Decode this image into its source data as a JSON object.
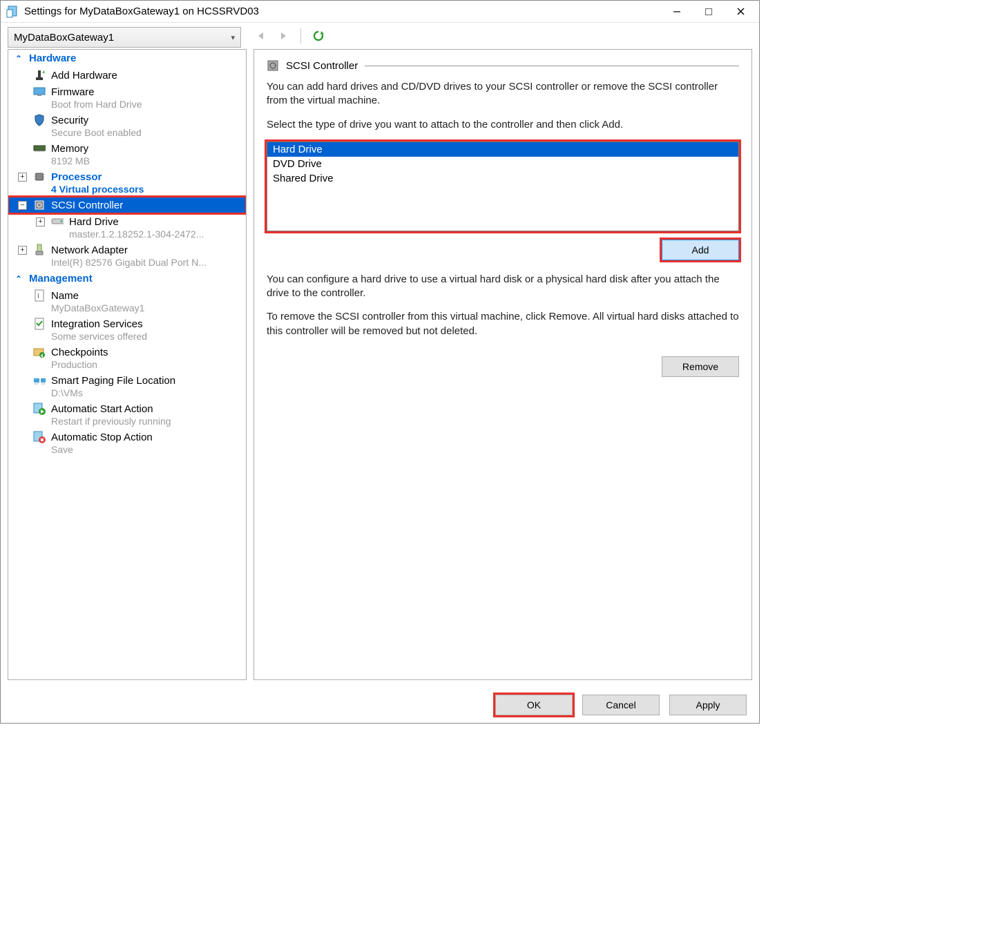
{
  "window": {
    "title": "Settings for MyDataBoxGateway1 on HCSSRVD03"
  },
  "toolbar": {
    "vm_name": "MyDataBoxGateway1"
  },
  "tree": {
    "hardware_label": "Hardware",
    "add_hardware": "Add Hardware",
    "firmware": "Firmware",
    "firmware_sub": "Boot from Hard Drive",
    "security": "Security",
    "security_sub": "Secure Boot enabled",
    "memory": "Memory",
    "memory_sub": "8192 MB",
    "processor": "Processor",
    "processor_sub": "4 Virtual processors",
    "scsi": "SCSI Controller",
    "hard_drive": "Hard Drive",
    "hard_drive_sub": "master.1.2.18252.1-304-2472...",
    "network": "Network Adapter",
    "network_sub": "Intel(R) 82576 Gigabit Dual Port N...",
    "management_label": "Management",
    "name": "Name",
    "name_sub": "MyDataBoxGateway1",
    "integration": "Integration Services",
    "integration_sub": "Some services offered",
    "checkpoints": "Checkpoints",
    "checkpoints_sub": "Production",
    "paging": "Smart Paging File Location",
    "paging_sub": "D:\\VMs",
    "autostart": "Automatic Start Action",
    "autostart_sub": "Restart if previously running",
    "autostop": "Automatic Stop Action",
    "autostop_sub": "Save"
  },
  "detail": {
    "heading": "SCSI Controller",
    "p1": "You can add hard drives and CD/DVD drives to your SCSI controller or remove the SCSI controller from the virtual machine.",
    "p2": "Select the type of drive you want to attach to the controller and then click Add.",
    "options": {
      "o0": "Hard Drive",
      "o1": "DVD Drive",
      "o2": "Shared Drive"
    },
    "add_label": "Add",
    "p3": "You can configure a hard drive to use a virtual hard disk or a physical hard disk after you attach the drive to the controller.",
    "p4": "To remove the SCSI controller from this virtual machine, click Remove. All virtual hard disks attached to this controller will be removed but not deleted.",
    "remove_label": "Remove"
  },
  "footer": {
    "ok": "OK",
    "cancel": "Cancel",
    "apply": "Apply"
  }
}
